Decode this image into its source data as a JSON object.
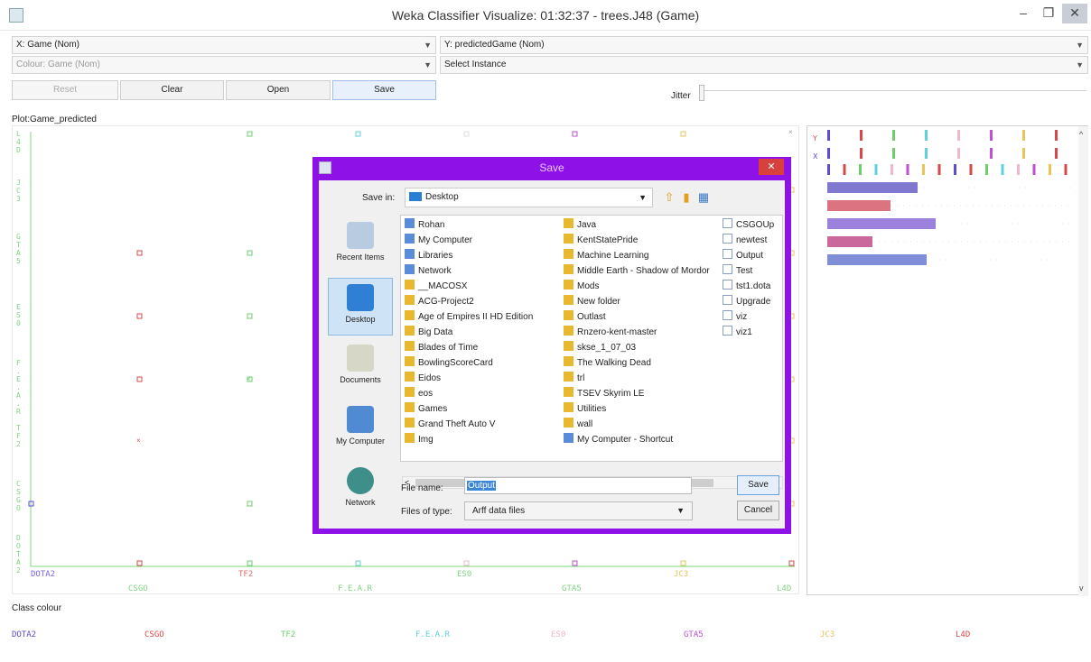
{
  "window": {
    "title": "Weka Classifier Visualize: 01:32:37 - trees.J48 (Game)",
    "minimize": "–",
    "maximize": "❐",
    "close": "✕"
  },
  "controls": {
    "x_axis": "X: Game (Nom)",
    "y_axis": "Y: predictedGame (Nom)",
    "colour": "Colour: Game (Nom)",
    "select_instance": "Select Instance",
    "buttons": [
      "Reset",
      "Clear",
      "Open",
      "Save"
    ],
    "jitter_label": "Jitter"
  },
  "plot": {
    "title": "Plot:Game_predicted",
    "y_tick_labels": [
      "L4D",
      "JC3",
      "GTA5",
      "ES0",
      "F.E.A.R",
      "TF2",
      "CSGO",
      "DOTA2"
    ],
    "x_tick_labels": [
      "DOTA2",
      "CSGO",
      "TF2",
      "F.E.A.R",
      "ES0",
      "GTA5",
      "JC3",
      "L4D"
    ],
    "x_label_colors": [
      "#7a64e8",
      "#7ed47e",
      "#e26a6a",
      "#7ed47e",
      "#7ed47e",
      "#7ed47e",
      "#e8c25a",
      "#7ed47e"
    ]
  },
  "legend": {
    "title": "Class colour",
    "items": [
      {
        "label": "DOTA2",
        "color": "#5a4ed6"
      },
      {
        "label": "CSGO",
        "color": "#d94848"
      },
      {
        "label": "TF2",
        "color": "#6ccf6c"
      },
      {
        "label": "F.E.A.R",
        "color": "#5dd2d8"
      },
      {
        "label": "ES0",
        "color": "#f2b8c8"
      },
      {
        "label": "GTA5",
        "color": "#c24dd6"
      },
      {
        "label": "JC3",
        "color": "#e8c45a"
      },
      {
        "label": "L4D",
        "color": "#d94848"
      }
    ]
  },
  "attr_panel": {
    "y_label": "Y",
    "x_label": "X"
  },
  "dialog": {
    "title": "Save",
    "close": "✕",
    "save_in_label": "Save in:",
    "save_in_value": "Desktop",
    "places": [
      "Recent Items",
      "Desktop",
      "Documents",
      "My Computer",
      "Network"
    ],
    "files_col1": [
      "Rohan",
      "My Computer",
      "Libraries",
      "Network",
      "__MACOSX",
      "ACG-Project2",
      "Age of Empires II HD Edition",
      "Big Data",
      "Blades of Time",
      "BowlingScoreCard",
      "Eidos",
      "eos",
      "Games",
      "Grand Theft Auto V",
      "Img"
    ],
    "files_col2": [
      "Java",
      "KentStatePride",
      "Machine Learning",
      "Middle Earth - Shadow of Mordor",
      "Mods",
      "New folder",
      "Outlast",
      "Rnzero-kent-master",
      "skse_1_07_03",
      "The Walking Dead",
      "trl",
      "TSEV Skyrim LE",
      "Utilities",
      "wall",
      "My Computer - Shortcut"
    ],
    "files_col3": [
      "CSGOUp",
      "newtest",
      "Output",
      "Test",
      "tst1.dota",
      "Upgrade",
      "viz",
      "viz1"
    ],
    "file_name_label": "File name:",
    "file_name_value": "Output",
    "files_of_type_label": "Files of type:",
    "files_of_type_value": "Arff data files",
    "save_button": "Save",
    "cancel_button": "Cancel"
  }
}
